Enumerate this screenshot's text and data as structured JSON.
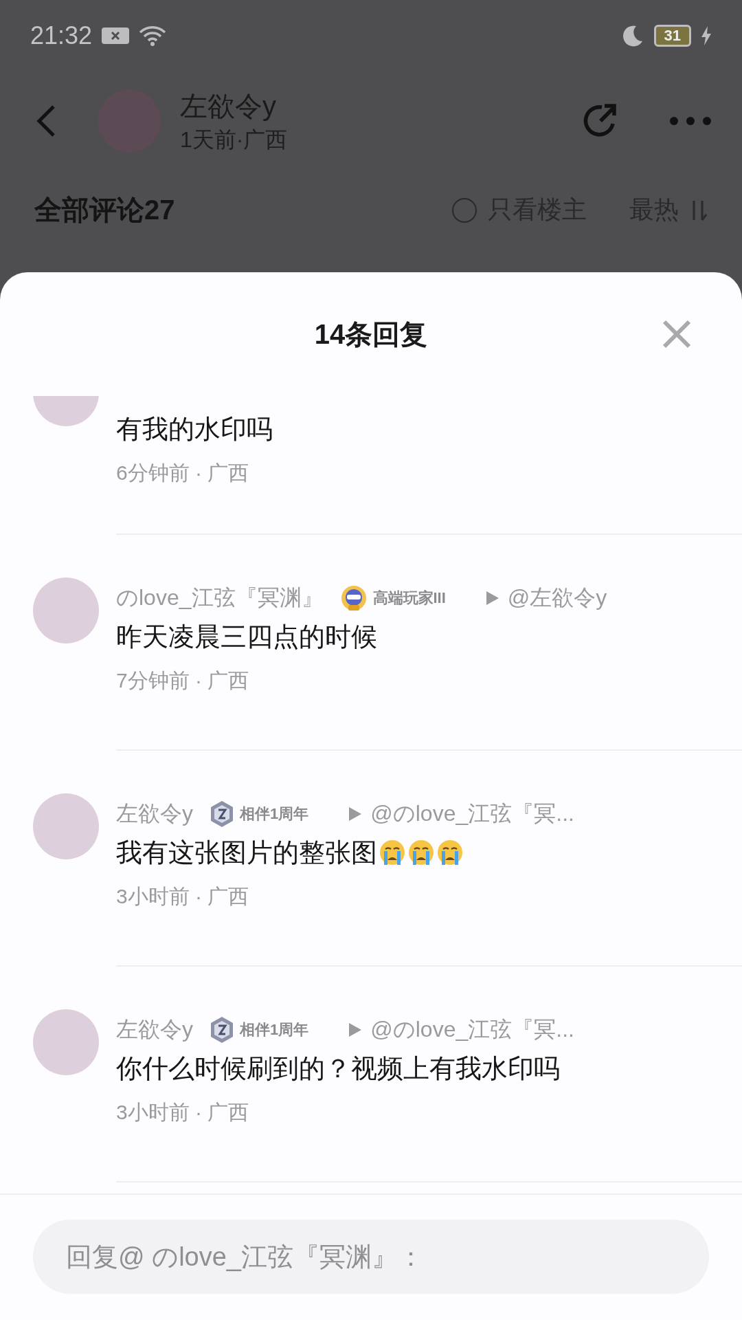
{
  "status_bar": {
    "time": "21:32",
    "battery": "31"
  },
  "post_header": {
    "author": "左欲令y",
    "meta": "1天前·广西"
  },
  "comments_bar": {
    "title": "全部评论27",
    "only_op": {
      "label": "只看楼主",
      "checked": false
    },
    "sort": "最热"
  },
  "sheet": {
    "title": "14条回复"
  },
  "replies": [
    {
      "kind": "partial",
      "text": "有我的水印吗",
      "time": "6分钟前 · 广西"
    },
    {
      "kind": "full",
      "name": "のlove_江弦『冥渊』",
      "badge": {
        "kind": "player",
        "label": "高端玩家III"
      },
      "reply_to": "@左欲令y",
      "text": "昨天凌晨三四点的时候",
      "time": "7分钟前 · 广西"
    },
    {
      "kind": "full",
      "name": "左欲令y",
      "badge": {
        "kind": "anniversary",
        "label": "相伴1周年"
      },
      "reply_to": "@のlove_江弦『冥...",
      "text": "我有这张图片的整张图",
      "emojis": [
        {
          "kind": "crying"
        },
        {
          "kind": "crying"
        },
        {
          "kind": "crying"
        }
      ],
      "time": "3小时前 · 广西"
    },
    {
      "kind": "full",
      "name": "左欲令y",
      "badge": {
        "kind": "anniversary",
        "label": "相伴1周年"
      },
      "reply_to": "@のlove_江弦『冥...",
      "text": "你什么时候刷到的？视频上有我水印吗",
      "time": "3小时前 · 广西"
    }
  ],
  "reply_input": {
    "placeholder": "回复@ のlove_江弦『冥渊』："
  }
}
